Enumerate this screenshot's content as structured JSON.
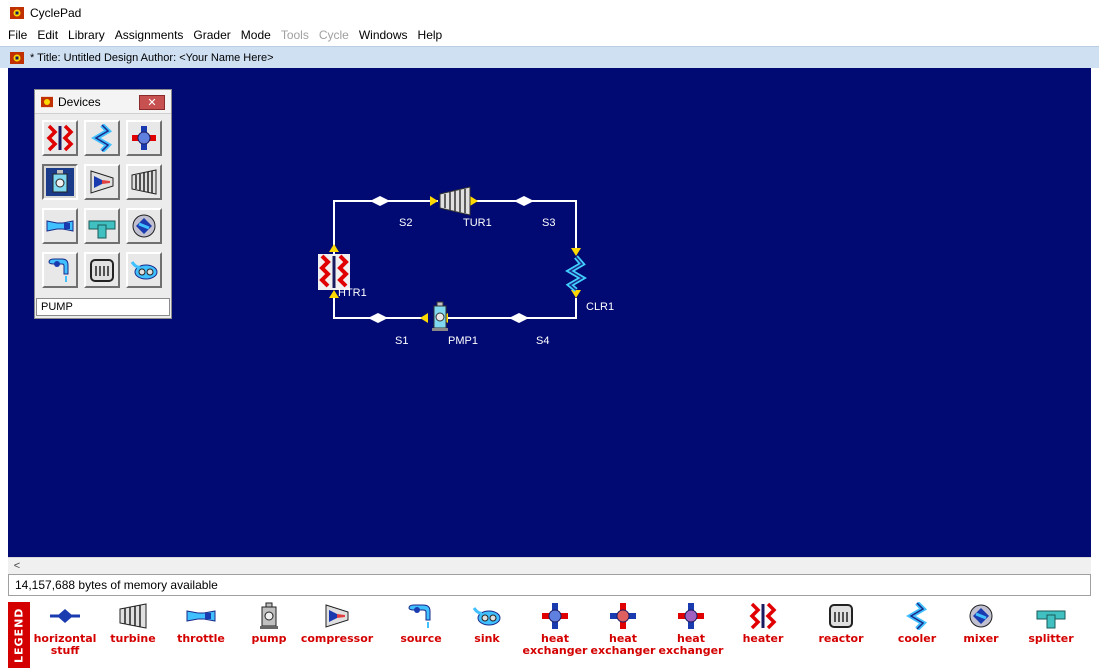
{
  "app": {
    "title": "CyclePad"
  },
  "menu": [
    {
      "label": "File",
      "enabled": true
    },
    {
      "label": "Edit",
      "enabled": true
    },
    {
      "label": "Library",
      "enabled": true
    },
    {
      "label": "Assignments",
      "enabled": true
    },
    {
      "label": "Grader",
      "enabled": true
    },
    {
      "label": "Mode",
      "enabled": true
    },
    {
      "label": "Tools",
      "enabled": false
    },
    {
      "label": "Cycle",
      "enabled": false
    },
    {
      "label": "Windows",
      "enabled": true
    },
    {
      "label": "Help",
      "enabled": true
    }
  ],
  "document": {
    "title_line": "* Title: Untitled Design   Author: <Your Name Here>"
  },
  "devices_palette": {
    "title": "Devices",
    "close_label": "✕",
    "selected": "PUMP",
    "buttons": [
      "heater",
      "cooler",
      "heat exchanger",
      "pump",
      "compressor",
      "turbine",
      "throttle",
      "splitter",
      "mixer",
      "source",
      "reactor",
      "sink"
    ]
  },
  "cycle": {
    "devices": [
      {
        "id": "TUR1",
        "type": "turbine"
      },
      {
        "id": "CLR1",
        "type": "cooler"
      },
      {
        "id": "PMP1",
        "type": "pump"
      },
      {
        "id": "HTR1",
        "type": "heater"
      }
    ],
    "streams": [
      {
        "id": "S1"
      },
      {
        "id": "S2"
      },
      {
        "id": "S3"
      },
      {
        "id": "S4"
      }
    ]
  },
  "scrollbar": {
    "left_arrow": "<"
  },
  "status": {
    "memory": "14,157,688 bytes of memory available"
  },
  "legend": {
    "tag": "LEGEND",
    "items": [
      {
        "name": "horizontal stuff",
        "icon": "horizontal-stuff-icon"
      },
      {
        "name": "turbine",
        "icon": "turbine-icon"
      },
      {
        "name": "throttle",
        "icon": "throttle-icon"
      },
      {
        "name": "pump",
        "icon": "pump-icon"
      },
      {
        "name": "compressor",
        "icon": "compressor-icon"
      },
      {
        "name": "source",
        "icon": "source-icon"
      },
      {
        "name": "sink",
        "icon": "sink-icon"
      },
      {
        "name": "heat exchanger",
        "icon": "heat-exchanger-icon"
      },
      {
        "name": "heat exchanger",
        "icon": "heat-exchanger-icon"
      },
      {
        "name": "heat exchanger",
        "icon": "heat-exchanger-icon"
      },
      {
        "name": "heater",
        "icon": "heater-icon"
      },
      {
        "name": "reactor",
        "icon": "reactor-icon"
      },
      {
        "name": "cooler",
        "icon": "cooler-icon"
      },
      {
        "name": "mixer",
        "icon": "mixer-icon"
      },
      {
        "name": "splitter",
        "icon": "splitter-icon"
      }
    ]
  },
  "colors": {
    "canvas": "#000a72",
    "legend_text": "#d40000",
    "arrow": "#ffd800",
    "pipe": "#ffffff"
  }
}
